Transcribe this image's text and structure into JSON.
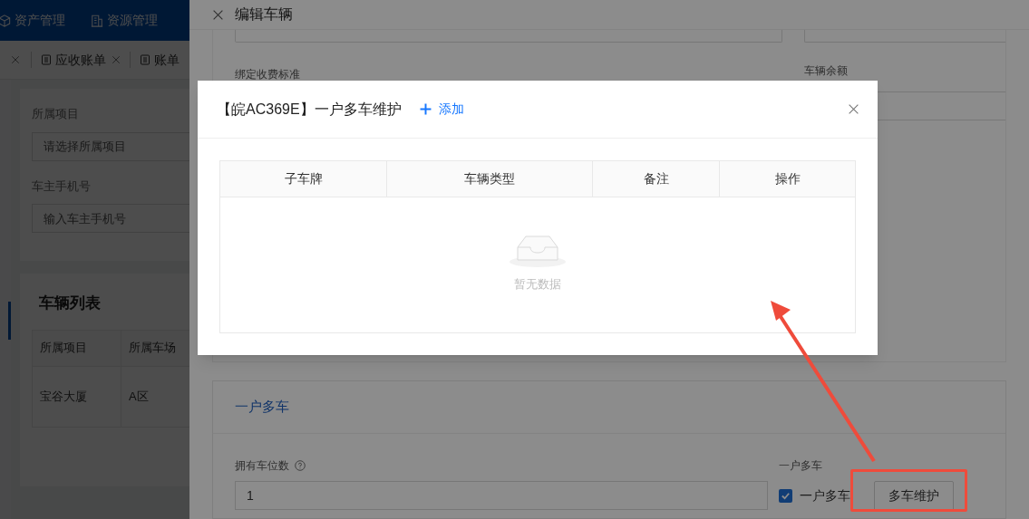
{
  "nav": [
    {
      "label": "资产管理",
      "kind": "cube"
    },
    {
      "label": "资源管理",
      "kind": "building"
    }
  ],
  "tabs": [
    {
      "label": "应收账单",
      "closable": true
    },
    {
      "label": "账单",
      "closable": false
    }
  ],
  "filters": [
    {
      "label": "所属项目",
      "placeholder": "请选择所属项目"
    },
    {
      "label": "车主手机号",
      "placeholder": "输入车主手机号"
    }
  ],
  "vehicle_list": {
    "title": "车辆列表",
    "columns": [
      "所属项目",
      "所属车场"
    ],
    "rows": [
      [
        "宝谷大厦",
        "A区"
      ]
    ]
  },
  "drawer": {
    "title": "编辑车辆",
    "labels": [
      "绑定收费标准",
      "车辆余额"
    ],
    "section": {
      "title": "一户多车",
      "spaces_label": "拥有车位数",
      "spaces_value": "1",
      "multi_label": "一户多车",
      "checkbox": {
        "label": "一户多车",
        "checked": true
      },
      "button": "多车维护"
    }
  },
  "modal": {
    "title": "【皖AC369E】一户多车维护",
    "add_label": "添加",
    "columns": [
      "子车牌",
      "车辆类型",
      "备注",
      "操作"
    ],
    "empty_text": "暂无数据"
  }
}
